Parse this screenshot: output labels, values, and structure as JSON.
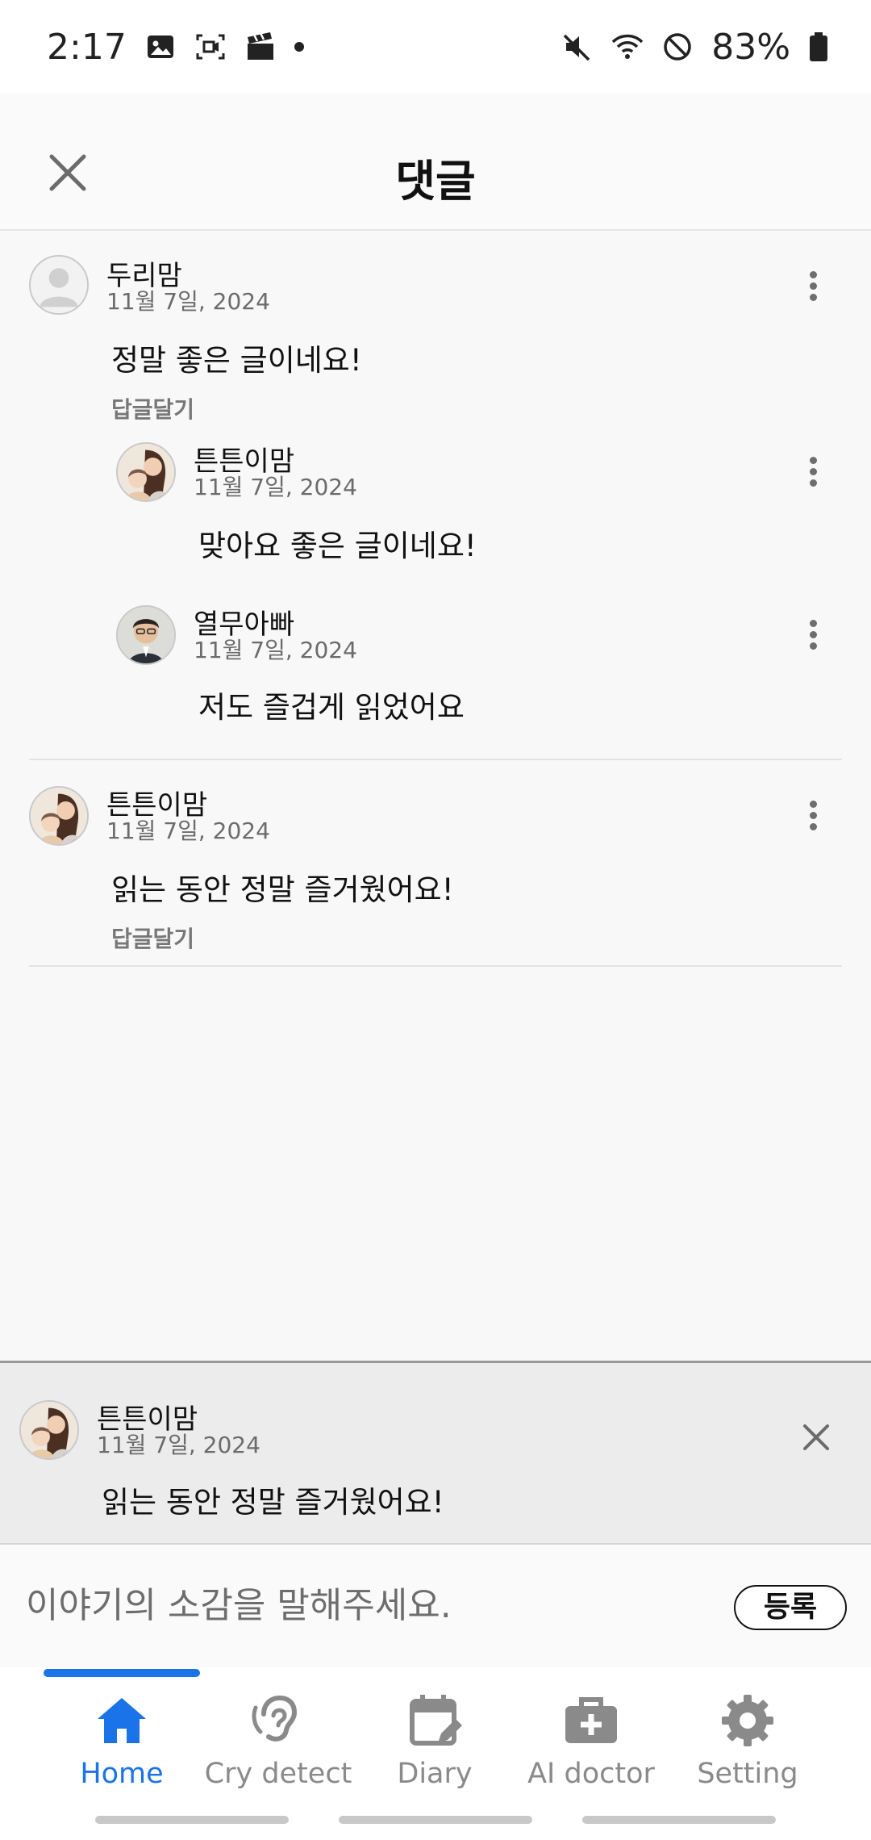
{
  "status_bar": {
    "time": "2:17",
    "battery": "83%"
  },
  "header": {
    "title": "댓글"
  },
  "comments": [
    {
      "author": "두리맘",
      "date": "11월 7일, 2024",
      "text": "정말 좋은 글이네요!",
      "reply_label": "답글달기",
      "avatar": "default-avatar-icon",
      "replies": [
        {
          "author": "튼튼이맘",
          "date": "11월 7일, 2024",
          "text": "맞아요 좋은 글이네요!",
          "avatar": "mother-child-avatar"
        },
        {
          "author": "열무아빠",
          "date": "11월 7일, 2024",
          "text": "저도 즐겁게 읽었어요",
          "avatar": "man-glasses-avatar"
        }
      ]
    },
    {
      "author": "튼튼이맘",
      "date": "11월 7일, 2024",
      "text": "읽는 동안 정말 즐거웠어요!",
      "reply_label": "답글달기",
      "avatar": "mother-child-avatar",
      "replies": []
    }
  ],
  "reply_preview": {
    "author": "튼튼이맘",
    "date": "11월 7일, 2024",
    "text": "읽는 동안 정말 즐거웠어요!"
  },
  "input": {
    "placeholder": "이야기의 소감을 말해주세요.",
    "value": "",
    "submit_label": "등록"
  },
  "nav": {
    "active": "Home",
    "items": [
      {
        "label": "Home",
        "icon": "home-icon"
      },
      {
        "label": "Cry detect",
        "icon": "ear-icon"
      },
      {
        "label": "Diary",
        "icon": "calendar-edit-icon"
      },
      {
        "label": "AI doctor",
        "icon": "medical-bag-icon"
      },
      {
        "label": "Setting",
        "icon": "gear-icon"
      }
    ]
  },
  "colors": {
    "accent": "#1a73e8",
    "inactive": "#8a8a8a",
    "background": "#f8f8f8"
  }
}
